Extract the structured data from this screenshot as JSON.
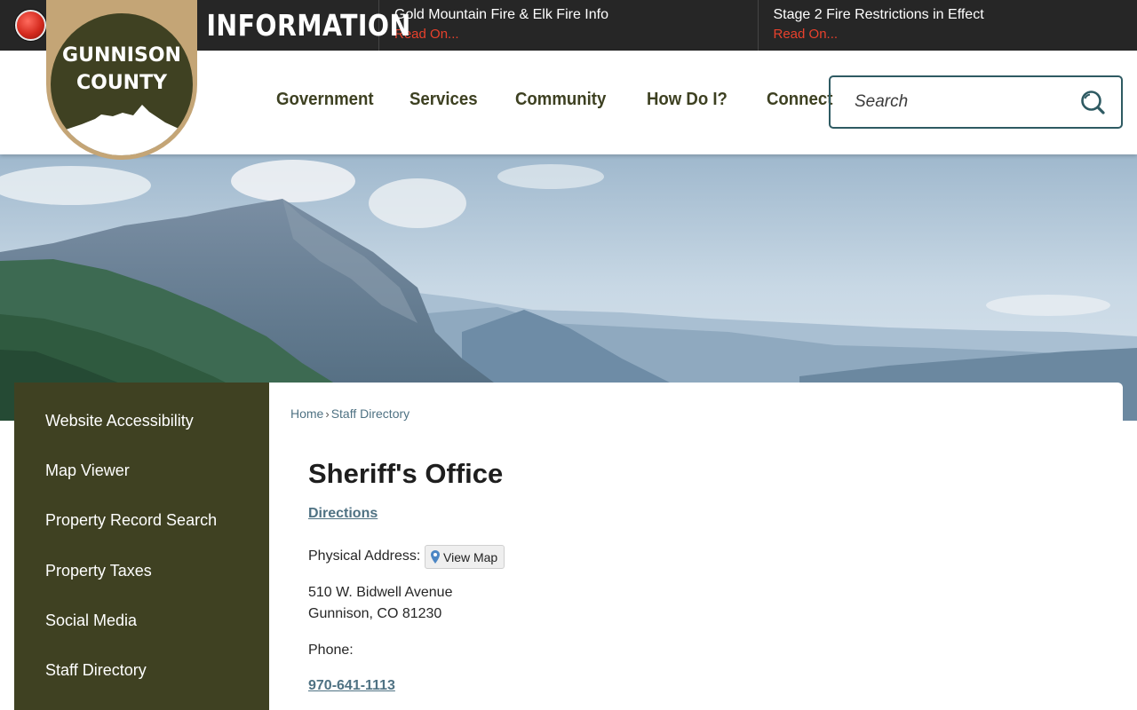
{
  "alert_bar": {
    "title": "WILDFIRE INFORMATION",
    "items": [
      {
        "title": "Gold Mountain Fire & Elk Fire Info",
        "link": "Read On..."
      },
      {
        "title": "Stage 2 Fire Restrictions in Effect",
        "link": "Read On..."
      }
    ]
  },
  "logo": {
    "line1": "GUNNISON",
    "line2": "COUNTY"
  },
  "nav": {
    "items": [
      "Government",
      "Services",
      "Community",
      "How Do I?",
      "Connect"
    ]
  },
  "search": {
    "placeholder": "Search"
  },
  "sidenav": {
    "items": [
      "Website Accessibility",
      "Map Viewer",
      "Property Record Search",
      "Property Taxes",
      "Social Media",
      "Staff Directory"
    ]
  },
  "breadcrumb": {
    "home": "Home",
    "separator": "›",
    "current": "Staff Directory"
  },
  "content": {
    "title": "Sheriff's Office",
    "directions": "Directions",
    "address_label": "Physical Address:",
    "view_map": "View Map",
    "address_line1": "510 W. Bidwell Avenue",
    "address_line2": "Gunnison, CO 81230",
    "phone_label": "Phone:",
    "phone": "970-641-1113"
  },
  "colors": {
    "alert_bg": "#262626",
    "alert_link": "#e8412c",
    "brand_olive": "#3f4122",
    "brand_tan": "#c4a576",
    "link": "#4f7283"
  }
}
